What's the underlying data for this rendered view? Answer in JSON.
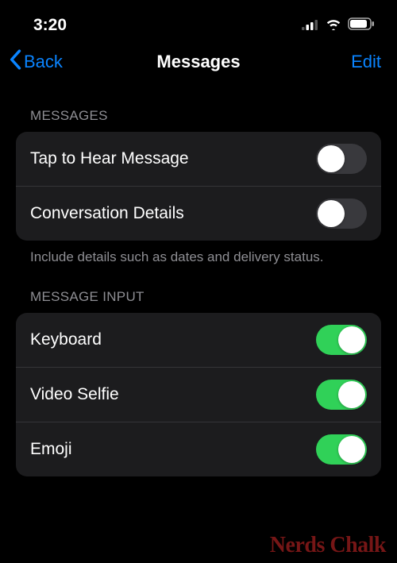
{
  "status": {
    "time": "3:20"
  },
  "nav": {
    "back": "Back",
    "title": "Messages",
    "edit": "Edit"
  },
  "sections": {
    "messages": {
      "header": "MESSAGES",
      "rows": {
        "tap_to_hear": {
          "label": "Tap to Hear Message",
          "on": false
        },
        "conversation_details": {
          "label": "Conversation Details",
          "on": false
        }
      },
      "footer": "Include details such as dates and delivery status."
    },
    "message_input": {
      "header": "MESSAGE INPUT",
      "rows": {
        "keyboard": {
          "label": "Keyboard",
          "on": true
        },
        "video_selfie": {
          "label": "Video Selfie",
          "on": true
        },
        "emoji": {
          "label": "Emoji",
          "on": true
        }
      }
    }
  },
  "watermark": "Nerds Chalk"
}
